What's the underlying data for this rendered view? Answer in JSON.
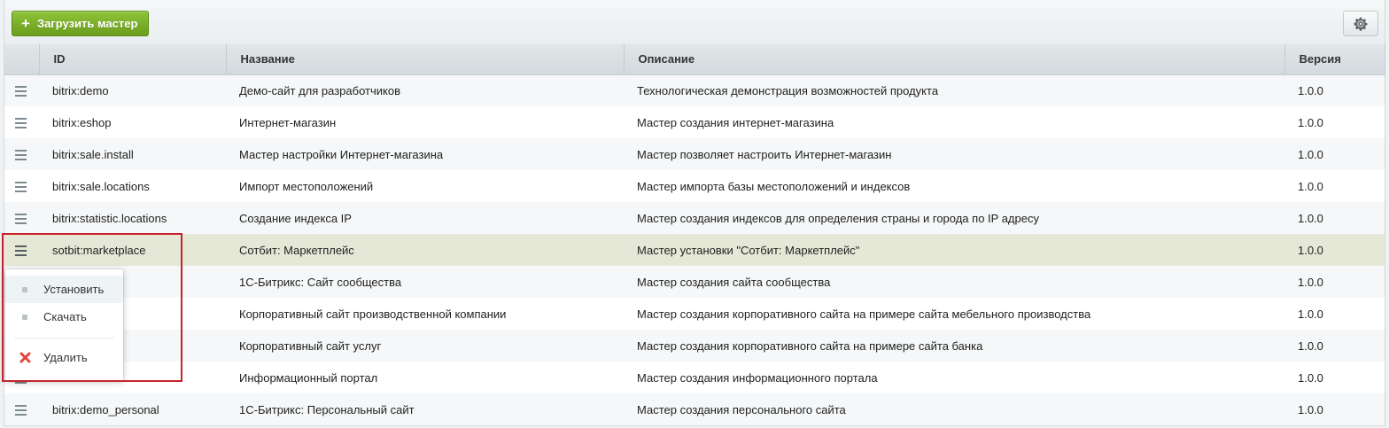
{
  "toolbar": {
    "load_button_label": "Загрузить мастер",
    "load_button_icon": "plus-icon",
    "settings_icon": "gear-icon",
    "accent_color": "#76ad21"
  },
  "table": {
    "columns": [
      "",
      "ID",
      "Название",
      "Описание",
      "Версия"
    ],
    "rows": [
      {
        "id": "bitrix:demo",
        "name": "Демо-сайт для разработчиков",
        "description": "Технологическая демонстрация возможностей продукта",
        "version": "1.0.0"
      },
      {
        "id": "bitrix:eshop",
        "name": "Интернет-магазин",
        "description": "Мастер создания интернет-магазина",
        "version": "1.0.0"
      },
      {
        "id": "bitrix:sale.install",
        "name": "Мастер настройки Интернет-магазина",
        "description": "Мастер позволяет настроить Интернет-магазин",
        "version": "1.0.0"
      },
      {
        "id": "bitrix:sale.locations",
        "name": "Импорт местоположений",
        "description": "Мастер импорта базы местоположений и индексов",
        "version": "1.0.0"
      },
      {
        "id": "bitrix:statistic.locations",
        "name": "Создание индекса IP",
        "description": "Мастер создания индексов для определения страны и города по IP адресу",
        "version": "1.0.0"
      },
      {
        "id": "sotbit:marketplace",
        "name": "Сотбит: Маркетплейс",
        "description": "Мастер установки \"Сотбит: Маркетплейс\"",
        "version": "1.0.0"
      },
      {
        "id": "ommunity",
        "name": "1С-Битрикс: Сайт сообщества",
        "description": "Мастер создания сайта сообщества",
        "version": "1.0.0"
      },
      {
        "id": "niture",
        "name": "Корпоративный сайт производственной компании",
        "description": "Мастер создания корпоративного сайта на примере сайта мебельного производства",
        "version": "1.0.0"
      },
      {
        "id": "rvices",
        "name": "Корпоративный сайт услуг",
        "description": "Мастер создания корпоративного сайта на примере сайта банка",
        "version": "1.0.0"
      },
      {
        "id": "ortal",
        "name": "Информационный портал",
        "description": "Мастер создания информационного портала",
        "version": "1.0.0"
      },
      {
        "id": "bitrix:demo_personal",
        "name": "1С-Битрикс: Персональный сайт",
        "description": "Мастер создания персонального сайта",
        "version": "1.0.0"
      }
    ],
    "selected_row_index": 5
  },
  "context_menu": {
    "items": [
      {
        "label": "Установить",
        "icon": "bullet-icon"
      },
      {
        "label": "Скачать",
        "icon": "bullet-icon"
      },
      {
        "label": "Удалить",
        "icon": "delete-x-icon"
      }
    ]
  },
  "highlight_color": "#c7232a"
}
